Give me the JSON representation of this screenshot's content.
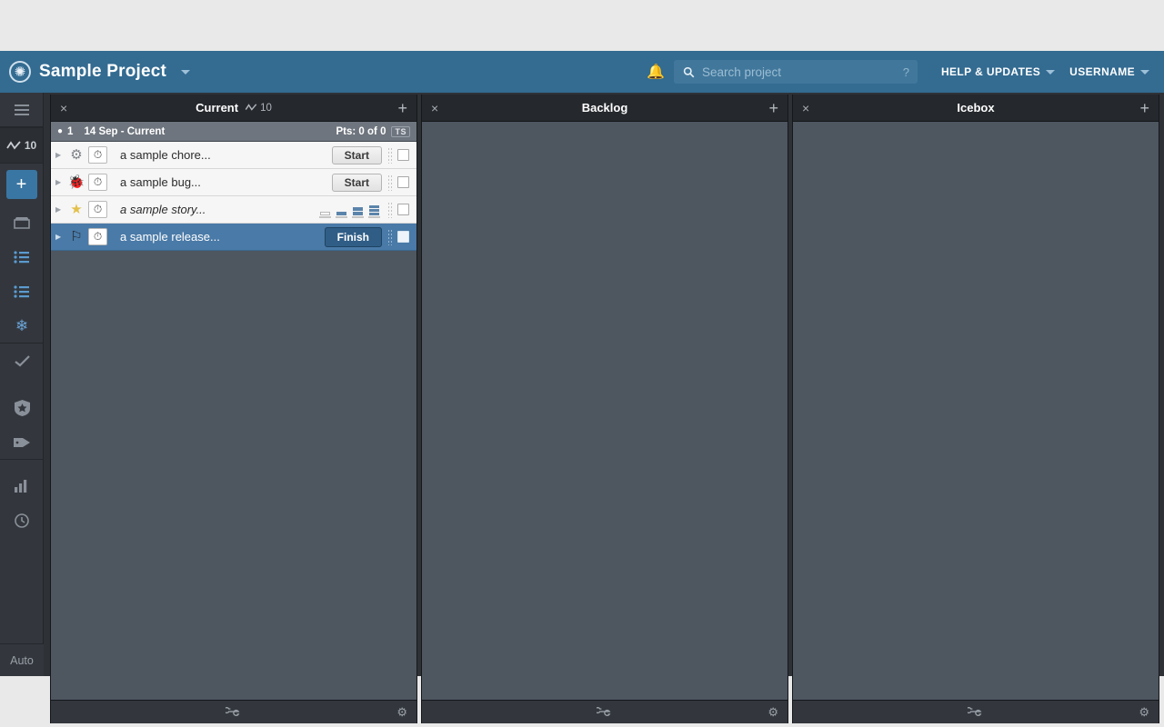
{
  "topbar": {
    "logo_icon": "asterisk-snowflake-logo",
    "project_name": "Sample Project",
    "notifications_icon": "bell-icon",
    "search": {
      "icon": "search-icon",
      "placeholder": "Search project",
      "value": "",
      "help_hint": "?"
    },
    "help_menu": "HELP & UPDATES",
    "user_menu": "USERNAME"
  },
  "rail": {
    "items": [
      {
        "name": "hamburger-menu",
        "icon": "☰",
        "label": ""
      },
      {
        "name": "velocity",
        "icon": "↗",
        "label": "10"
      },
      {
        "name": "add-story",
        "icon": "+",
        "label": ""
      },
      {
        "name": "my-work",
        "icon": "☰",
        "label": ""
      },
      {
        "name": "current-iteration",
        "icon": "≡",
        "label": ""
      },
      {
        "name": "backlog",
        "icon": "≡",
        "label": ""
      },
      {
        "name": "icebox",
        "icon": "❄",
        "label": ""
      },
      {
        "name": "done",
        "icon": "✔",
        "label": ""
      },
      {
        "name": "epics",
        "icon": "★",
        "label": ""
      },
      {
        "name": "labels",
        "icon": "◈",
        "label": ""
      },
      {
        "name": "analytics",
        "icon": "█",
        "label": ""
      },
      {
        "name": "history",
        "icon": "◴",
        "label": ""
      }
    ],
    "velocity_value": "10",
    "auto_label": "Auto"
  },
  "panels": [
    {
      "id": "current",
      "title": "Current",
      "velocity_icon": "trend-icon",
      "velocity": "10",
      "close_icon": "×",
      "add_icon": "+",
      "iteration": {
        "dot": "●",
        "number": "1",
        "label": "14 Sep - Current",
        "points": "Pts: 0 of 0",
        "badge": "TS"
      },
      "stories": [
        {
          "type": "chore",
          "type_icon": "gear-icon",
          "timer_icon": "stopwatch-icon",
          "name": "a sample chore...",
          "action": "Start",
          "action_style": "start",
          "italic": false,
          "selected": false,
          "checkbox": false
        },
        {
          "type": "bug",
          "type_icon": "bug-icon",
          "timer_icon": "stopwatch-icon",
          "name": "a sample bug...",
          "action": "Start",
          "action_style": "start",
          "italic": false,
          "selected": false,
          "checkbox": false
        },
        {
          "type": "feature",
          "type_icon": "star-icon",
          "timer_icon": "stopwatch-icon",
          "name": "a sample story...",
          "action": "",
          "action_style": "estimate",
          "estimate_options": [
            1,
            2,
            4,
            8
          ],
          "italic": true,
          "selected": false,
          "checkbox": false
        },
        {
          "type": "release",
          "type_icon": "flag-icon",
          "timer_icon": "stopwatch-icon",
          "name": "a sample release...",
          "action": "Finish",
          "action_style": "finish",
          "italic": false,
          "selected": true,
          "checkbox": false
        }
      ],
      "footer": {
        "link_icon": "link-icon",
        "gear_icon": "gear-icon"
      }
    },
    {
      "id": "backlog",
      "title": "Backlog",
      "velocity_icon": "",
      "velocity": "",
      "close_icon": "×",
      "add_icon": "+",
      "iteration": null,
      "stories": [],
      "footer": {
        "link_icon": "link-icon",
        "gear_icon": "gear-icon"
      }
    },
    {
      "id": "icebox",
      "title": "Icebox",
      "velocity_icon": "",
      "velocity": "",
      "close_icon": "×",
      "add_icon": "+",
      "iteration": null,
      "stories": [],
      "footer": {
        "link_icon": "link-icon",
        "gear_icon": "gear-icon"
      }
    }
  ],
  "colors": {
    "brand_blue": "#336b91",
    "panel_bg": "#4e5660",
    "panel_head": "#25282c",
    "rail_bg": "#33373d",
    "selected_row": "#4a7aa7",
    "accent_button": "#3a76a3"
  }
}
